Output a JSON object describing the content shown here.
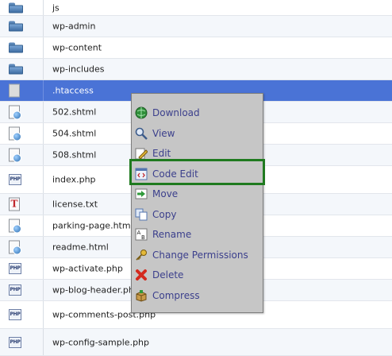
{
  "files": [
    {
      "name": "js",
      "type": "folder"
    },
    {
      "name": "wp-admin",
      "type": "folder"
    },
    {
      "name": "wp-content",
      "type": "folder"
    },
    {
      "name": "wp-includes",
      "type": "folder"
    },
    {
      "name": ".htaccess",
      "type": "file-gray",
      "selected": true
    },
    {
      "name": "502.shtml",
      "type": "shtml"
    },
    {
      "name": "504.shtml",
      "type": "shtml"
    },
    {
      "name": "508.shtml",
      "type": "shtml"
    },
    {
      "name": "index.php",
      "type": "php"
    },
    {
      "name": "license.txt",
      "type": "txt"
    },
    {
      "name": "parking-page.html",
      "type": "shtml"
    },
    {
      "name": "readme.html",
      "type": "shtml"
    },
    {
      "name": "wp-activate.php",
      "type": "php"
    },
    {
      "name": "wp-blog-header.php",
      "type": "php"
    },
    {
      "name": "wp-comments-post.php",
      "type": "php"
    },
    {
      "name": "wp-config-sample.php",
      "type": "php"
    }
  ],
  "icon_labels": {
    "php": "PHP",
    "txt": "T"
  },
  "context_menu": {
    "items": [
      {
        "label": "Download",
        "icon": "globe-download-icon"
      },
      {
        "label": "View",
        "icon": "magnifier-icon"
      },
      {
        "label": "Edit",
        "icon": "pencil-icon"
      },
      {
        "label": "Code Edit",
        "icon": "code-edit-icon",
        "highlighted": true
      },
      {
        "label": "Move",
        "icon": "arrow-move-icon"
      },
      {
        "label": "Copy",
        "icon": "copy-icon"
      },
      {
        "label": "Rename",
        "icon": "rename-ab-icon"
      },
      {
        "label": "Change Permissions",
        "icon": "key-icon"
      },
      {
        "label": "Delete",
        "icon": "red-x-delete-icon"
      },
      {
        "label": "Compress",
        "icon": "archive-box-icon"
      }
    ]
  },
  "colors": {
    "selected_row": "#4a73d6",
    "menu_text": "#3b3f8c",
    "highlight_border": "#1f7a1f"
  }
}
